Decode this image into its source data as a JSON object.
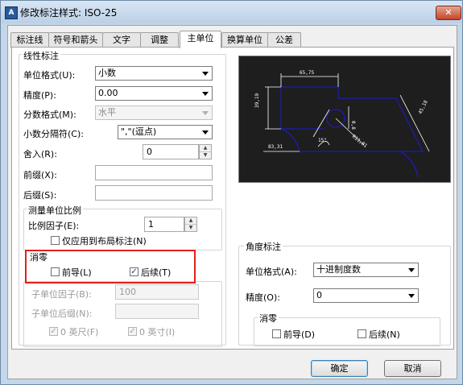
{
  "window": {
    "title": "修改标注样式: ISO-25",
    "close_icon": "✕"
  },
  "tabs": [
    "标注线",
    "符号和箭头",
    "文字",
    "调整",
    "主单位",
    "换算单位",
    "公差"
  ],
  "active_tab": 4,
  "linear": {
    "title": "线性标注",
    "unit_format_label": "单位格式(U):",
    "unit_format_value": "小数",
    "precision_label": "精度(P):",
    "precision_value": "0.00",
    "fraction_label": "分数格式(M):",
    "fraction_value": "水平",
    "decimal_sep_label": "小数分隔符(C):",
    "decimal_sep_value": "\",\"(逗点)",
    "roundoff_label": "舍入(R):",
    "roundoff_value": "0",
    "prefix_label": "前缀(X):",
    "prefix_value": "",
    "suffix_label": "后缀(S):",
    "suffix_value": ""
  },
  "scale": {
    "title": "测量单位比例",
    "factor_label": "比例因子(E):",
    "factor_value": "1",
    "layout_label": "仅应用到布局标注(N)",
    "layout_checked": false
  },
  "zero_linear": {
    "title": "消零",
    "leading_label": "前导(L)",
    "leading_checked": false,
    "trailing_label": "后续(T)",
    "trailing_checked": true,
    "sub_factor_label": "子单位因子(B):",
    "sub_factor_value": "100",
    "sub_suffix_label": "子单位后缀(N):",
    "sub_suffix_value": "",
    "feet_label": "0 英尺(F)",
    "feet_checked": true,
    "inches_label": "0 英寸(I)",
    "inches_checked": true
  },
  "angular": {
    "title": "角度标注",
    "unit_format_label": "单位格式(A):",
    "unit_format_value": "十进制度数",
    "precision_label": "精度(O):",
    "precision_value": "0",
    "zero_title": "消零",
    "leading_label": "前导(D)",
    "leading_checked": false,
    "trailing_label": "后续(N)",
    "trailing_checked": false
  },
  "preview": {
    "dim_top": "65,75",
    "dim_left": "39,19",
    "dim_right": "45,18",
    "dim_bottom": "83,31",
    "dim_angle": "15°",
    "dim_radius": "R11,81",
    "dim_small": "0,8"
  },
  "buttons": {
    "ok": "确定",
    "cancel": "取消"
  },
  "colors": {
    "preview_bg": "#1e1e1e",
    "preview_shape": "#1c1cb4",
    "preview_dim": "#ffffff",
    "highlight": "#e0221a"
  }
}
